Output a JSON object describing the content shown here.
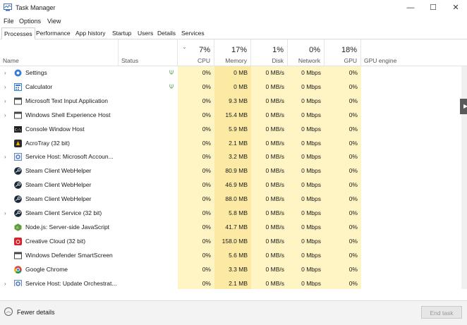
{
  "window": {
    "title": "Task Manager",
    "minimize": "—",
    "maximize": "☐",
    "close": "✕"
  },
  "menu": [
    "File",
    "Options",
    "View"
  ],
  "tabs": [
    "Processes",
    "Performance",
    "App history",
    "Startup",
    "Users",
    "Details",
    "Services"
  ],
  "header": {
    "name": "Name",
    "status": "Status",
    "sort_icon": "chevron-down-icon",
    "cpu": {
      "pct": "7%",
      "label": "CPU"
    },
    "memory": {
      "pct": "17%",
      "label": "Memory"
    },
    "disk": {
      "pct": "1%",
      "label": "Disk"
    },
    "network": {
      "pct": "0%",
      "label": "Network"
    },
    "gpu": {
      "pct": "18%",
      "label": "GPU"
    },
    "gpu_engine": "GPU engine"
  },
  "rows": [
    {
      "name": "Settings",
      "icon": "gear-icon",
      "expandable": true,
      "suspended": true,
      "cpu": "0%",
      "memory": "0 MB",
      "disk": "0 MB/s",
      "network": "0 Mbps",
      "gpu": "0%"
    },
    {
      "name": "Calculator",
      "icon": "calculator-icon",
      "expandable": true,
      "suspended": true,
      "cpu": "0%",
      "memory": "0 MB",
      "disk": "0 MB/s",
      "network": "0 Mbps",
      "gpu": "0%"
    },
    {
      "name": "Microsoft Text Input Application",
      "icon": "app-window-icon",
      "expandable": true,
      "suspended": false,
      "cpu": "0%",
      "memory": "9.3 MB",
      "disk": "0 MB/s",
      "network": "0 Mbps",
      "gpu": "0%"
    },
    {
      "name": "Windows Shell Experience Host",
      "icon": "app-window-icon",
      "expandable": true,
      "suspended": false,
      "cpu": "0%",
      "memory": "15.4 MB",
      "disk": "0 MB/s",
      "network": "0 Mbps",
      "gpu": "0%"
    },
    {
      "name": "Console Window Host",
      "icon": "console-icon",
      "expandable": false,
      "suspended": false,
      "cpu": "0%",
      "memory": "5.9 MB",
      "disk": "0 MB/s",
      "network": "0 Mbps",
      "gpu": "0%"
    },
    {
      "name": "AcroTray (32 bit)",
      "icon": "acrotray-icon",
      "expandable": false,
      "suspended": false,
      "cpu": "0%",
      "memory": "2.1 MB",
      "disk": "0 MB/s",
      "network": "0 Mbps",
      "gpu": "0%"
    },
    {
      "name": "Service Host: Microsoft Accoun...",
      "icon": "service-host-icon",
      "expandable": true,
      "suspended": false,
      "cpu": "0%",
      "memory": "3.2 MB",
      "disk": "0 MB/s",
      "network": "0 Mbps",
      "gpu": "0%"
    },
    {
      "name": "Steam Client WebHelper",
      "icon": "steam-icon",
      "expandable": false,
      "suspended": false,
      "cpu": "0%",
      "memory": "80.9 MB",
      "disk": "0 MB/s",
      "network": "0 Mbps",
      "gpu": "0%"
    },
    {
      "name": "Steam Client WebHelper",
      "icon": "steam-icon",
      "expandable": false,
      "suspended": false,
      "cpu": "0%",
      "memory": "46.9 MB",
      "disk": "0 MB/s",
      "network": "0 Mbps",
      "gpu": "0%"
    },
    {
      "name": "Steam Client WebHelper",
      "icon": "steam-icon",
      "expandable": false,
      "suspended": false,
      "cpu": "0%",
      "memory": "88.0 MB",
      "disk": "0 MB/s",
      "network": "0 Mbps",
      "gpu": "0%"
    },
    {
      "name": "Steam Client Service (32 bit)",
      "icon": "steam-icon",
      "expandable": true,
      "suspended": false,
      "cpu": "0%",
      "memory": "5.8 MB",
      "disk": "0 MB/s",
      "network": "0 Mbps",
      "gpu": "0%"
    },
    {
      "name": "Node.js: Server-side JavaScript",
      "icon": "nodejs-icon",
      "expandable": false,
      "suspended": false,
      "cpu": "0%",
      "memory": "41.7 MB",
      "disk": "0 MB/s",
      "network": "0 Mbps",
      "gpu": "0%"
    },
    {
      "name": "Creative Cloud (32 bit)",
      "icon": "creative-cloud-icon",
      "expandable": false,
      "suspended": false,
      "cpu": "0%",
      "memory": "158.0 MB",
      "disk": "0 MB/s",
      "network": "0 Mbps",
      "gpu": "0%"
    },
    {
      "name": "Windows Defender SmartScreen",
      "icon": "app-window-icon",
      "expandable": false,
      "suspended": false,
      "cpu": "0%",
      "memory": "5.6 MB",
      "disk": "0 MB/s",
      "network": "0 Mbps",
      "gpu": "0%"
    },
    {
      "name": "Google Chrome",
      "icon": "chrome-icon",
      "expandable": false,
      "suspended": false,
      "cpu": "0%",
      "memory": "3.3 MB",
      "disk": "0 MB/s",
      "network": "0 Mbps",
      "gpu": "0%"
    },
    {
      "name": "Service Host: Update Orchestrat...",
      "icon": "service-host-icon",
      "expandable": true,
      "suspended": false,
      "cpu": "0%",
      "memory": "2.1 MB",
      "disk": "0 MB/s",
      "network": "0 Mbps",
      "gpu": "0%"
    }
  ],
  "footer": {
    "fewer_details": "Fewer details",
    "end_task": "End task"
  },
  "colors": {
    "heat_light": "#fff4c4",
    "heat_memory": "#fbe9a4",
    "accent_green": "#3e8e3e",
    "steam": "#1b2838"
  }
}
